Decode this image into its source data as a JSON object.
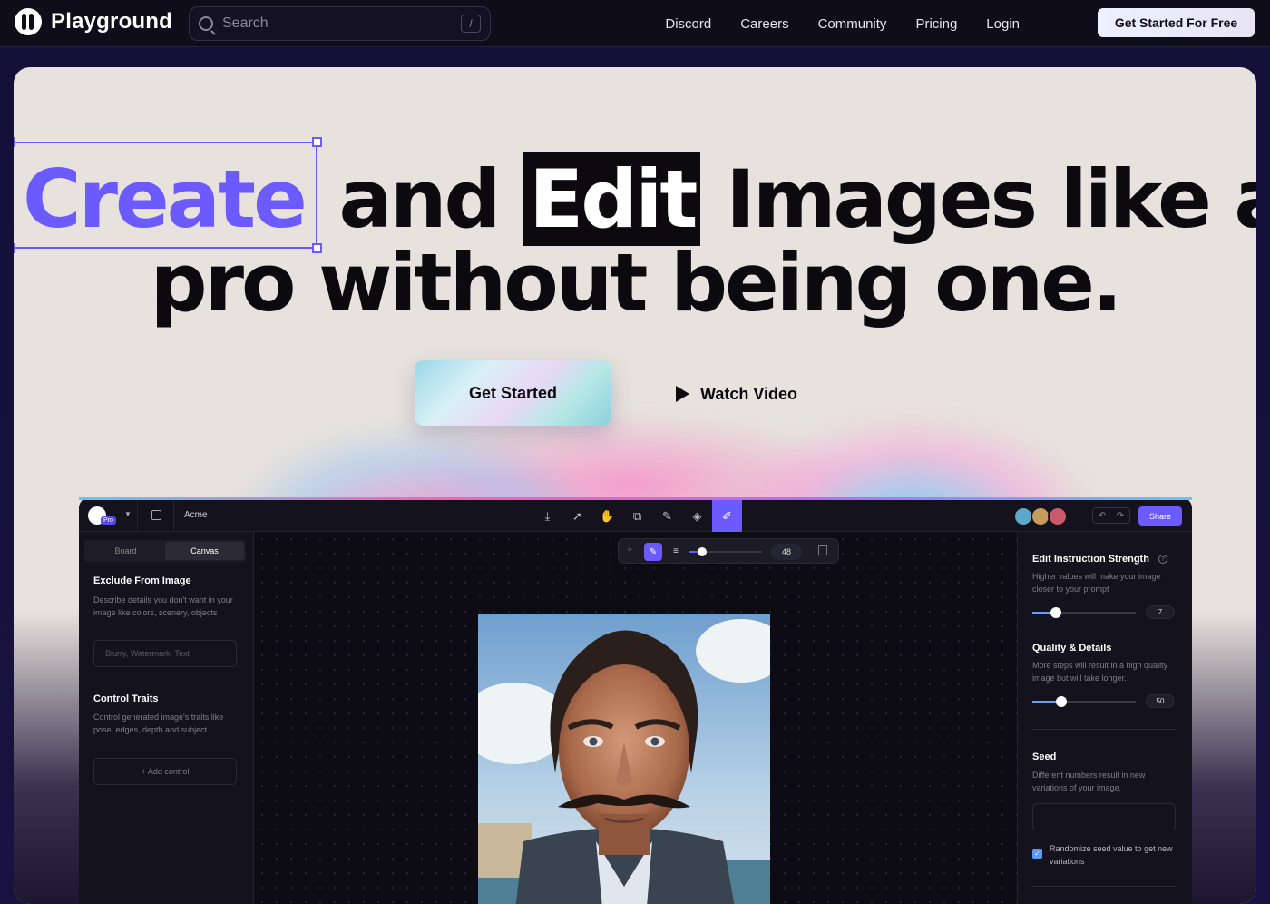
{
  "nav": {
    "brand": "Playground",
    "search_placeholder": "Search",
    "search_shortcut": "/",
    "links": [
      "Discord",
      "Careers",
      "Community",
      "Pricing",
      "Login"
    ],
    "cta": "Get Started For Free"
  },
  "hero": {
    "word_create": "Create",
    "word_and": "and",
    "word_edit": "Edit",
    "rest_line1": "Images like a",
    "line2": "pro without being one.",
    "primary_button": "Get Started",
    "secondary_button": "Watch Video"
  },
  "editor": {
    "plan_badge": "Pro",
    "project_name": "Acme",
    "share_label": "Share",
    "tabs": [
      "Board",
      "Canvas"
    ],
    "active_tab": "Canvas",
    "left": {
      "exclude_title": "Exclude From Image",
      "exclude_desc": "Describe details you don't want in your image like colors, scenery, objects",
      "exclude_placeholder": "Blurry, Watermark, Text",
      "control_title": "Control Traits",
      "control_desc": "Control generated image's traits like pose, edges, depth and subject.",
      "add_control": "+ Add control"
    },
    "brush_size": "48",
    "right": {
      "strength_title": "Edit Instruction Strength",
      "strength_desc": "Higher values will make your image closer to your prompt",
      "strength_value": "7",
      "quality_title": "Quality & Details",
      "quality_desc": "More steps will result in a high quality image but will take longer.",
      "quality_value": "50",
      "seed_title": "Seed",
      "seed_desc": "Different numbers result in new variations of your image.",
      "randomize_label": "Randomize seed value to get new variations"
    }
  },
  "colors": {
    "accent": "#6b5bff",
    "hero_bg": "#e7e2dd",
    "nav_bg": "#0f0d19"
  }
}
